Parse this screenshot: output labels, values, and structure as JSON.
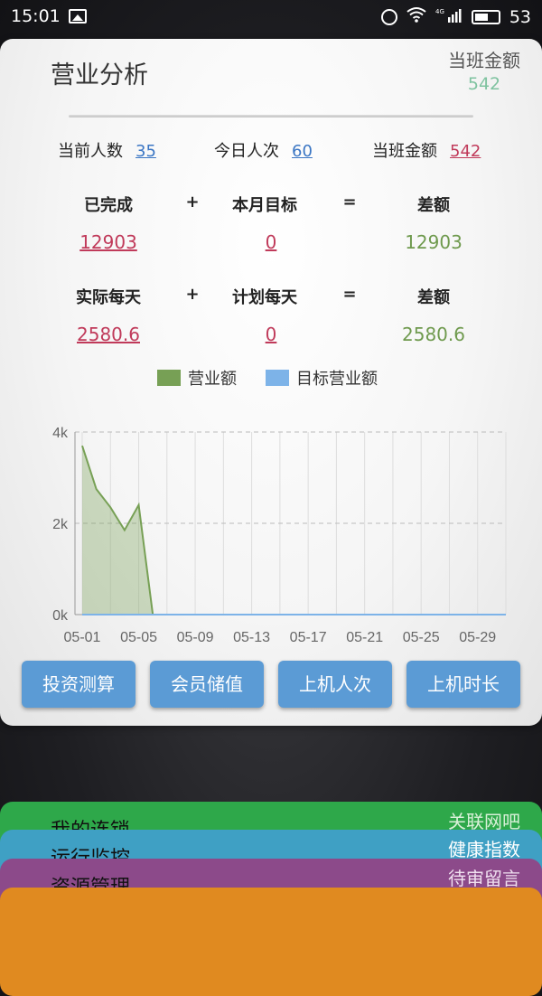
{
  "status_bar": {
    "time": "15:01",
    "battery": "53",
    "network": "4G"
  },
  "header": {
    "title": "营业分析",
    "shift_label": "当班金额",
    "shift_value": "542"
  },
  "stats": [
    {
      "label": "当前人数",
      "value": "35"
    },
    {
      "label": "今日人次",
      "value": "60"
    },
    {
      "label": "当班金额",
      "value": "542"
    }
  ],
  "calc1": {
    "h1": "已完成",
    "op1": "+",
    "h2": "本月目标",
    "op2": "=",
    "h3": "差额",
    "v1": "12903",
    "v2": "0",
    "v3": "12903"
  },
  "calc2": {
    "h1": "实际每天",
    "op1": "+",
    "h2": "计划每天",
    "op2": "=",
    "h3": "差额",
    "v1": "2580.6",
    "v2": "0",
    "v3": "2580.6"
  },
  "legend": [
    {
      "name": "营业额",
      "color": "#77a055"
    },
    {
      "name": "目标营业额",
      "color": "#7db3e8"
    }
  ],
  "chart_data": {
    "type": "area",
    "x": [
      "05-01",
      "05-02",
      "05-03",
      "05-04",
      "05-05",
      "05-06",
      "05-07",
      "05-08",
      "05-09",
      "05-10",
      "05-11",
      "05-12",
      "05-13",
      "05-14",
      "05-15",
      "05-16",
      "05-17",
      "05-18",
      "05-19",
      "05-20",
      "05-21",
      "05-22",
      "05-23",
      "05-24",
      "05-25",
      "05-26",
      "05-27",
      "05-28",
      "05-29",
      "05-30",
      "05-31"
    ],
    "x_ticks": [
      "05-01",
      "05-05",
      "05-09",
      "05-13",
      "05-17",
      "05-21",
      "05-25",
      "05-29"
    ],
    "y_ticks": [
      "0k",
      "2k",
      "4k"
    ],
    "ylim": [
      0,
      4000
    ],
    "series": [
      {
        "name": "营业额",
        "color": "#77a055",
        "values": [
          3700,
          2750,
          2350,
          1850,
          2400,
          0,
          0,
          0,
          0,
          0,
          0,
          0,
          0,
          0,
          0,
          0,
          0,
          0,
          0,
          0,
          0,
          0,
          0,
          0,
          0,
          0,
          0,
          0,
          0,
          0,
          0
        ]
      },
      {
        "name": "目标营业额",
        "color": "#7db3e8",
        "values": [
          0,
          0,
          0,
          0,
          0,
          0,
          0,
          0,
          0,
          0,
          0,
          0,
          0,
          0,
          0,
          0,
          0,
          0,
          0,
          0,
          0,
          0,
          0,
          0,
          0,
          0,
          0,
          0,
          0,
          0,
          0
        ]
      }
    ],
    "grid": true
  },
  "buttons": [
    "投资测算",
    "会员储值",
    "上机人次",
    "上机时长"
  ],
  "stack_cards": [
    {
      "left": "我的连锁",
      "right": "关联网吧",
      "color": "#2ea84a",
      "right_color": "#d8f0d8"
    },
    {
      "left": "运行监控",
      "right": "健康指数",
      "color": "#3fa0c4",
      "right_color": "#ffffff"
    },
    {
      "left": "资源管理",
      "right": "待审留言",
      "color": "#8c4a8a",
      "right_color": "#f0e0f0"
    },
    {
      "left": "",
      "right": "",
      "color": "#e08a20",
      "right_color": "#ffffff"
    }
  ]
}
